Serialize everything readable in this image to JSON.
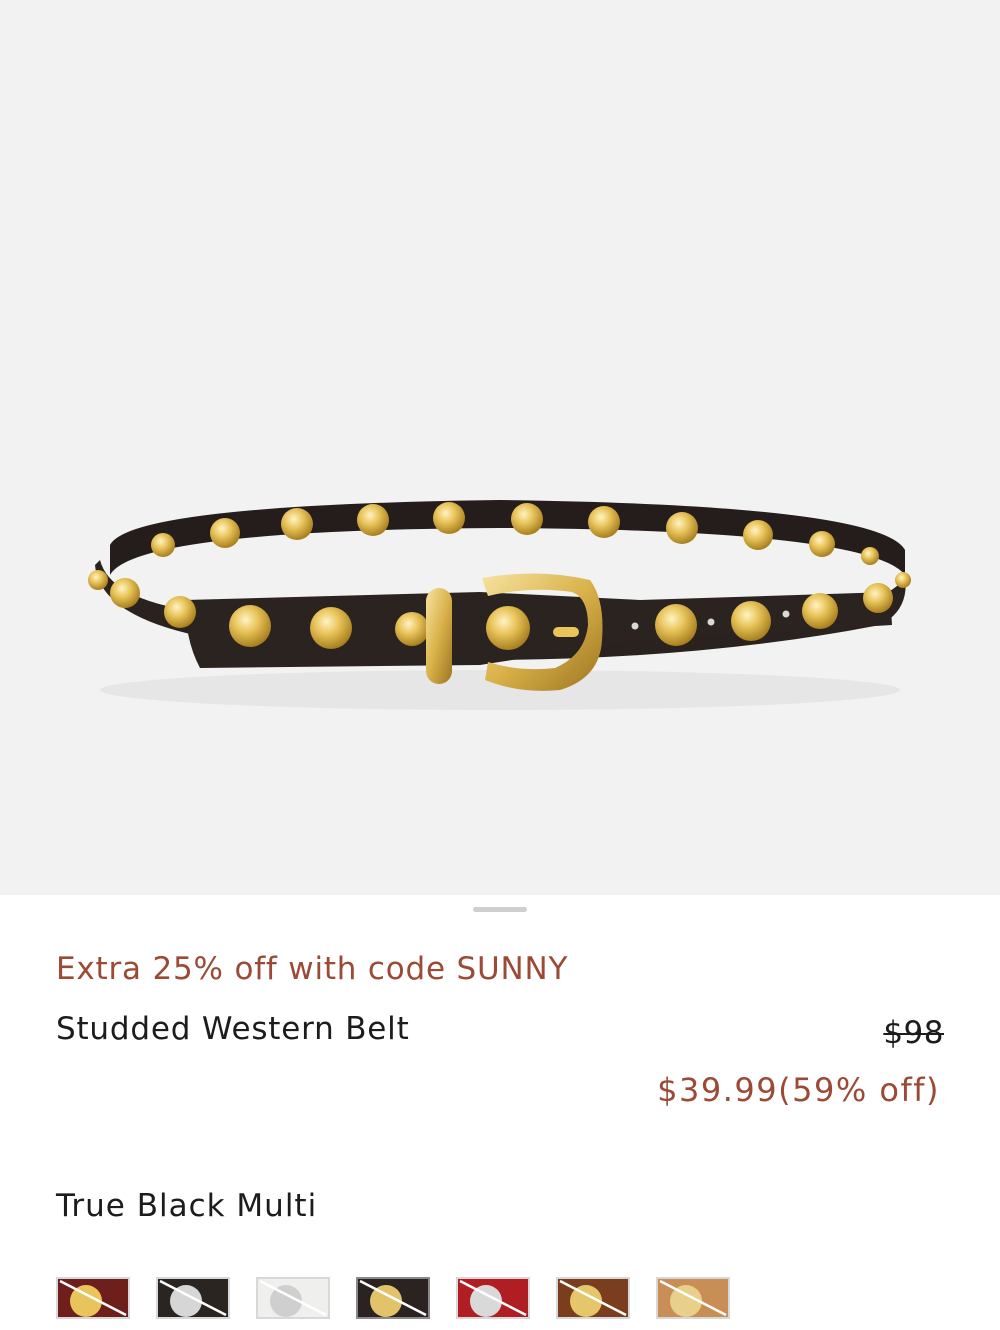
{
  "product": {
    "image_alt": "Studded Western Belt",
    "promo_text": "Extra 25% off with code SUNNY",
    "name": "Studded Western Belt",
    "original_price": "$98",
    "sale_price": "$39.99(59% off)",
    "color_name": "True Black Multi"
  },
  "swatches": [
    {
      "name": "swatch-burgundy",
      "base": "#6e1f1c",
      "stud": "#e8c45a"
    },
    {
      "name": "swatch-black-silver",
      "base": "#2b2522",
      "stud": "#d6d6d6"
    },
    {
      "name": "swatch-white",
      "base": "#efefee",
      "stud": "#cfcfcf"
    },
    {
      "name": "swatch-black-gold",
      "base": "#2a2321",
      "stud": "#e3c36a"
    },
    {
      "name": "swatch-red",
      "base": "#b01e24",
      "stud": "#d9d9d9"
    },
    {
      "name": "swatch-brown",
      "base": "#7a3e1e",
      "stud": "#e6c66a"
    },
    {
      "name": "swatch-tan",
      "base": "#c98e55",
      "stud": "#e8cf8a"
    }
  ],
  "colors": {
    "accent": "#9b4a35",
    "text": "#1c1c1c",
    "hero_bg": "#f2f2f2"
  }
}
